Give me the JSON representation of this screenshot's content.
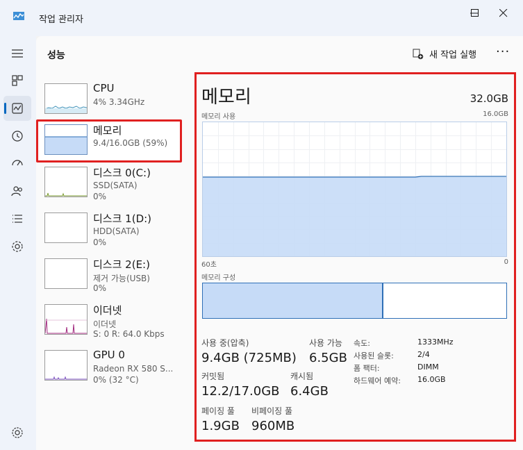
{
  "window": {
    "title": "작업 관리자"
  },
  "header": {
    "page_title": "성능",
    "new_task_label": "새 작업 실행",
    "more_label": "···"
  },
  "nav": {
    "items": [
      "menu-icon",
      "processes-icon",
      "performance-icon",
      "app-history-icon",
      "startup-apps-icon",
      "users-icon",
      "details-icon",
      "services-icon"
    ],
    "settings": "gear-icon"
  },
  "tiles": [
    {
      "name": "CPU",
      "sub1": "4% 3.34GHz",
      "sub2": ""
    },
    {
      "name": "메모리",
      "sub1": "9.4/16.0GB (59%)",
      "sub2": ""
    },
    {
      "name": "디스크 0(C:)",
      "sub1": "SSD(SATA)",
      "sub2": "0%"
    },
    {
      "name": "디스크 1(D:)",
      "sub1": "HDD(SATA)",
      "sub2": "0%"
    },
    {
      "name": "디스크 2(E:)",
      "sub1": "제거 가능(USB)",
      "sub2": "0%"
    },
    {
      "name": "이더넷",
      "sub1": "이더넷",
      "sub2": "S: 0 R: 64.0 Kbps"
    },
    {
      "name": "GPU 0",
      "sub1": "Radeon RX 580 S...",
      "sub2": "0% (32 °C)"
    }
  ],
  "detail": {
    "title": "메모리",
    "total": "32.0GB",
    "usage_label": "메모리 사용",
    "usage_max": "16.0GB",
    "time_left": "60초",
    "time_right": "0",
    "usage_fraction": 0.59,
    "composition_label": "메모리 구성",
    "composition_used_fraction": 0.59,
    "stats": {
      "in_use_label": "사용 중(압축)",
      "in_use_value": "9.4GB (725MB)",
      "available_label": "사용 가능",
      "available_value": "6.5GB",
      "committed_label": "커밋됨",
      "committed_value": "12.2/17.0GB",
      "cached_label": "캐시됨",
      "cached_value": "6.4GB",
      "paged_label": "페이징 풀",
      "paged_value": "1.9GB",
      "nonpaged_label": "비페이징 풀",
      "nonpaged_value": "960MB"
    },
    "props": [
      {
        "key": "속도:",
        "value": "1333MHz"
      },
      {
        "key": "사용된 슬롯:",
        "value": "2/4"
      },
      {
        "key": "폼 팩터:",
        "value": "DIMM"
      },
      {
        "key": "하드웨어 예약:",
        "value": "16.0GB"
      }
    ]
  },
  "colors": {
    "accent": "#0067c0",
    "highlight": "#e02020",
    "memory_fill": "#c6dbf7",
    "memory_line": "#2e6fb7",
    "cpu_line": "#3a8fb7",
    "ethernet_line": "#a0277d",
    "gpu_line": "#7b4fbf"
  }
}
